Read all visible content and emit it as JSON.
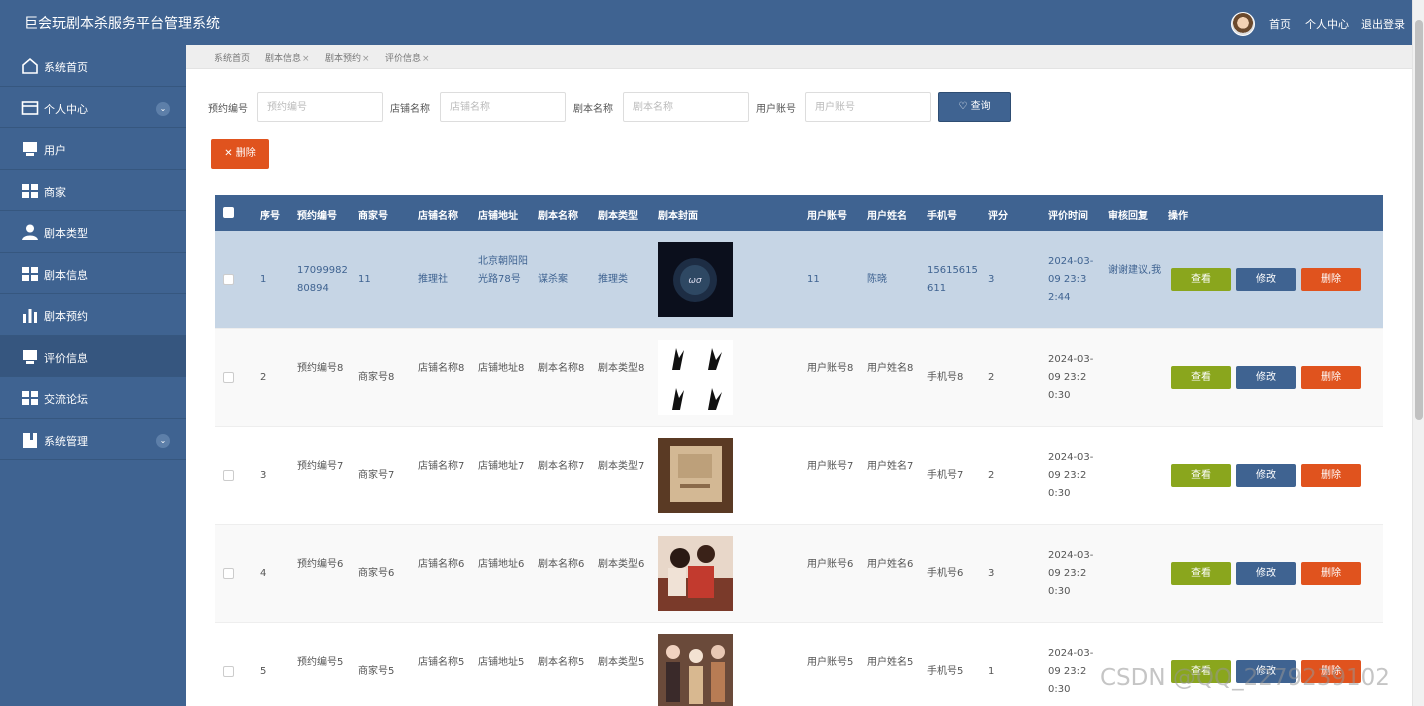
{
  "app": {
    "title": "巨会玩剧本杀服务平台管理系统",
    "top_links": [
      "首页",
      "个人中心",
      "退出登录"
    ]
  },
  "sidebar": {
    "items": [
      {
        "label": "系统首页",
        "icon": "home-icon",
        "chevron": false
      },
      {
        "label": "个人中心",
        "icon": "card-icon",
        "chevron": true
      },
      {
        "label": "用户",
        "icon": "monitor-icon",
        "chevron": false
      },
      {
        "label": "商家",
        "icon": "grid-icon",
        "chevron": false
      },
      {
        "label": "剧本类型",
        "icon": "user-icon",
        "chevron": false
      },
      {
        "label": "剧本信息",
        "icon": "grid-icon",
        "chevron": false
      },
      {
        "label": "剧本预约",
        "icon": "bar-chart-icon",
        "chevron": false
      },
      {
        "label": "评价信息",
        "icon": "monitor-icon",
        "chevron": false,
        "active": true
      },
      {
        "label": "交流论坛",
        "icon": "grid-icon",
        "chevron": false
      },
      {
        "label": "系统管理",
        "icon": "book-icon",
        "chevron": true
      }
    ]
  },
  "tabs": [
    {
      "label": "系统首页",
      "closable": false
    },
    {
      "label": "剧本信息",
      "closable": true
    },
    {
      "label": "剧本预约",
      "closable": true
    },
    {
      "label": "评价信息",
      "closable": true
    }
  ],
  "search": {
    "fields": [
      {
        "label": "预约编号",
        "placeholder": "预约编号"
      },
      {
        "label": "店铺名称",
        "placeholder": "店铺名称"
      },
      {
        "label": "剧本名称",
        "placeholder": "剧本名称"
      },
      {
        "label": "用户账号",
        "placeholder": "用户账号"
      }
    ],
    "button": "查询"
  },
  "toolbar": {
    "delete_label": "删除"
  },
  "table": {
    "headers": [
      "序号",
      "预约编号",
      "商家号",
      "店铺名称",
      "店铺地址",
      "剧本名称",
      "剧本类型",
      "剧本封面",
      "用户账号",
      "用户姓名",
      "手机号",
      "评分",
      "评价时间",
      "审核回复",
      "操作"
    ],
    "actions": {
      "view": "查看",
      "edit": "修改",
      "delete": "删除"
    },
    "rows": [
      {
        "seq": "1",
        "order_no": "1709998280894",
        "merchant": "11",
        "shop": "推理社",
        "address": "北京朝阳阳光路78号",
        "script": "谋杀案",
        "type": "推理类",
        "account": "11",
        "name": "陈晓",
        "phone": "15615615611",
        "score": "3",
        "time": "2024-03-09 23:32:44",
        "reply": "谢谢建议,我",
        "selected": true
      },
      {
        "seq": "2",
        "order_no": "预约编号8",
        "merchant": "商家号8",
        "shop": "店铺名称8",
        "address": "店铺地址8",
        "script": "剧本名称8",
        "type": "剧本类型8",
        "account": "用户账号8",
        "name": "用户姓名8",
        "phone": "手机号8",
        "score": "2",
        "time": "2024-03-09 23:20:30",
        "reply": ""
      },
      {
        "seq": "3",
        "order_no": "预约编号7",
        "merchant": "商家号7",
        "shop": "店铺名称7",
        "address": "店铺地址7",
        "script": "剧本名称7",
        "type": "剧本类型7",
        "account": "用户账号7",
        "name": "用户姓名7",
        "phone": "手机号7",
        "score": "2",
        "time": "2024-03-09 23:20:30",
        "reply": ""
      },
      {
        "seq": "4",
        "order_no": "预约编号6",
        "merchant": "商家号6",
        "shop": "店铺名称6",
        "address": "店铺地址6",
        "script": "剧本名称6",
        "type": "剧本类型6",
        "account": "用户账号6",
        "name": "用户姓名6",
        "phone": "手机号6",
        "score": "3",
        "time": "2024-03-09 23:20:30",
        "reply": ""
      },
      {
        "seq": "5",
        "order_no": "预约编号5",
        "merchant": "商家号5",
        "shop": "店铺名称5",
        "address": "店铺地址5",
        "script": "剧本名称5",
        "type": "剧本类型5",
        "account": "用户账号5",
        "name": "用户姓名5",
        "phone": "手机号5",
        "score": "1",
        "time": "2024-03-09 23:20:30",
        "reply": ""
      }
    ]
  },
  "watermark": "CSDN @QQ_2279239102"
}
